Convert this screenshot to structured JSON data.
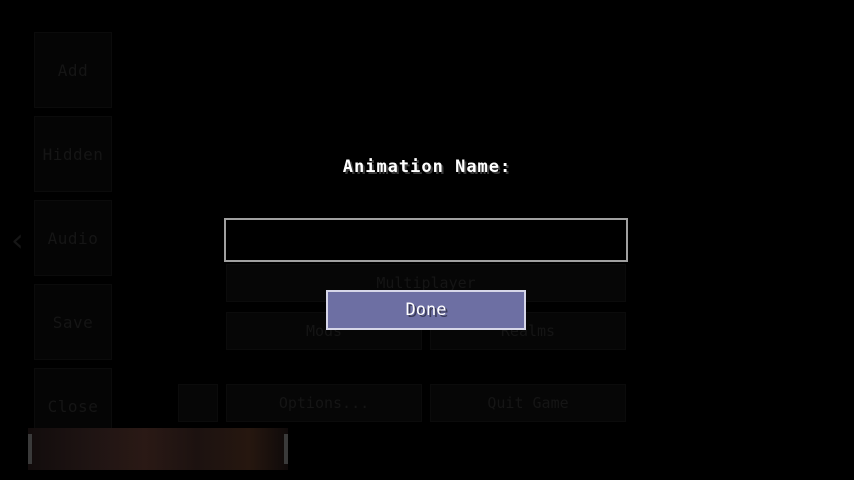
{
  "background_menu": {
    "side_buttons": [
      "Add",
      "Hidden",
      "Audio",
      "Save",
      "Close"
    ],
    "back_arrow": "‹",
    "buttons": {
      "multiplayer": "Multiplayer",
      "mods": "Mods",
      "realms": "Realms",
      "options": "Options...",
      "quit": "Quit Game"
    }
  },
  "dialog": {
    "title": "Animation Name:",
    "input_value": "",
    "done_label": "Done"
  },
  "colors": {
    "done_button": "#6d6fa3",
    "input_border": "#a0a0a0",
    "background": "#000000"
  }
}
